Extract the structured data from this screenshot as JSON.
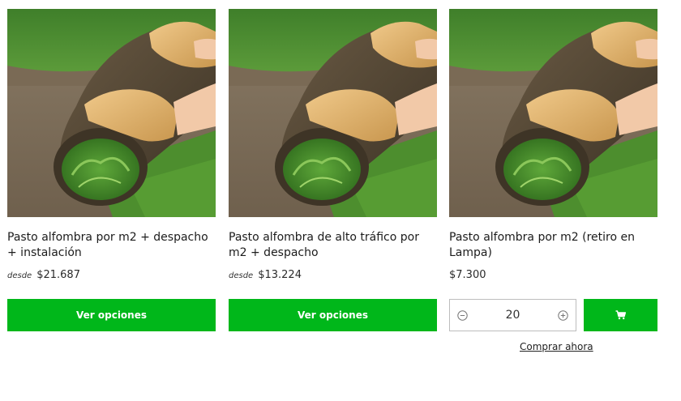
{
  "products": [
    {
      "title": "Pasto alfombra por m2 + despacho + instalación",
      "price_prefix": "desde",
      "price": "$21.687",
      "button_label": "Ver opciones",
      "image": "grass-roll-photo"
    },
    {
      "title": "Pasto alfombra de alto tráfico por m2 + despacho",
      "price_prefix": "desde",
      "price": "$13.224",
      "button_label": "Ver opciones",
      "image": "grass-roll-photo"
    },
    {
      "title": "Pasto alfombra por m2 (retiro en Lampa)",
      "price": "$7.300",
      "quantity": "20",
      "buy_now_label": "Comprar ahora",
      "image": "grass-roll-photo",
      "icons": {
        "decrease": "minus-circle-icon",
        "increase": "plus-circle-icon",
        "cart": "cart-icon"
      }
    }
  ],
  "colors": {
    "accent": "#00b71a",
    "button_text": "#ffffff",
    "border": "#bdbdbd"
  }
}
